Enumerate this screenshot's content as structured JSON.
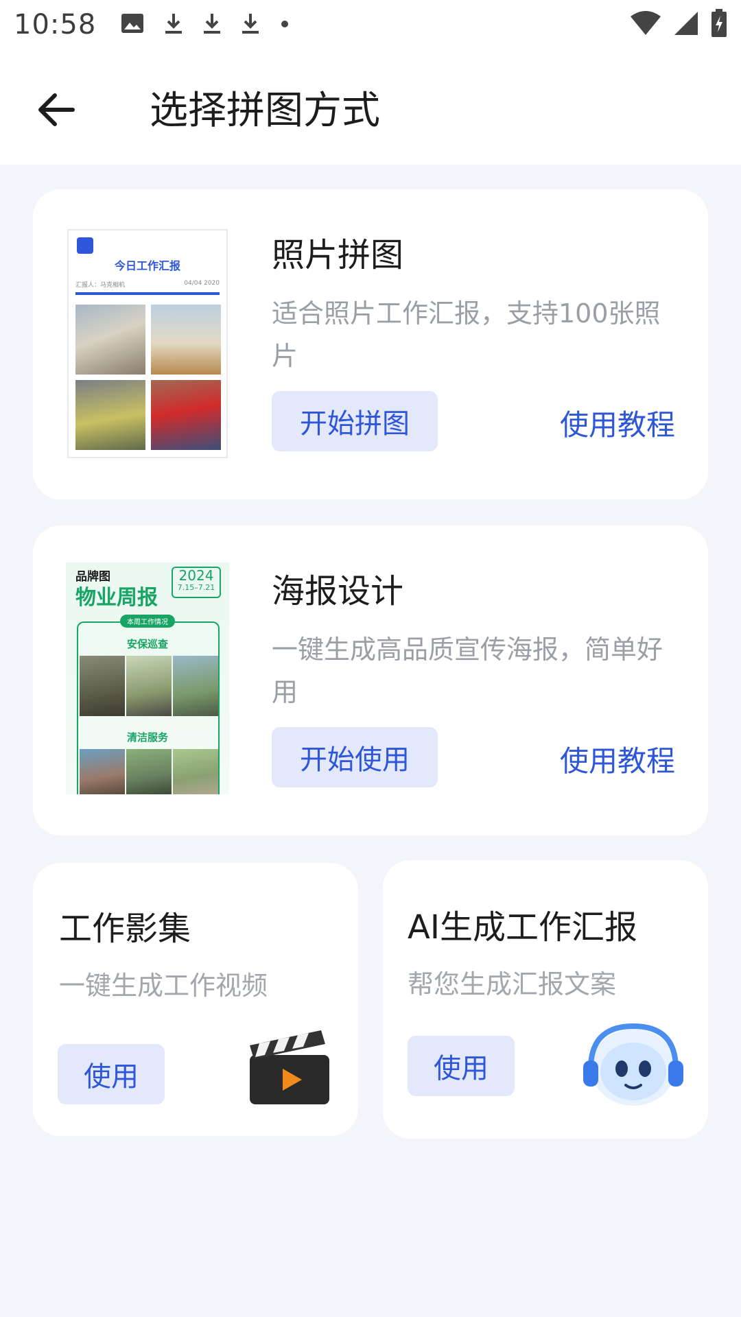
{
  "status_bar": {
    "time": "10:58",
    "icons": [
      "image-icon",
      "download-icon",
      "download-icon",
      "download-icon",
      "dot-icon",
      "wifi-icon",
      "signal-icon",
      "battery-charging-icon"
    ]
  },
  "app_bar": {
    "back_icon": "arrow-left-icon",
    "title": "选择拼图方式"
  },
  "cards": [
    {
      "title": "照片拼图",
      "description": "适合照片工作汇报，支持100张照片",
      "primary_button": "开始拼图",
      "tutorial_link": "使用教程",
      "thumbnail": {
        "badge": "马克",
        "title": "今日工作汇报",
        "reporter": "汇报人：马克相机",
        "date": "04/04 2020"
      }
    },
    {
      "title": "海报设计",
      "description": "一键生成高品质宣传海报，简单好用",
      "primary_button": "开始使用",
      "tutorial_link": "使用教程",
      "thumbnail": {
        "brand": "品牌图",
        "headline": "物业周报",
        "year": "2024",
        "date_range": "7.15–7.21",
        "section_label": "本周工作情况",
        "section1": "安保巡查",
        "section2": "清洁服务"
      }
    }
  ],
  "small_cards": [
    {
      "title": "工作影集",
      "description": "一键生成工作视频",
      "button": "使用",
      "icon": "clapperboard-icon"
    },
    {
      "title": "AI生成工作汇报",
      "description": "帮您生成汇报文案",
      "button": "使用",
      "icon": "robot-headset-icon"
    }
  ],
  "colors": {
    "accent": "#2d56d8",
    "button_bg": "#e3e8fb",
    "page_bg": "#f3f5fa",
    "poster_green": "#17a464"
  }
}
